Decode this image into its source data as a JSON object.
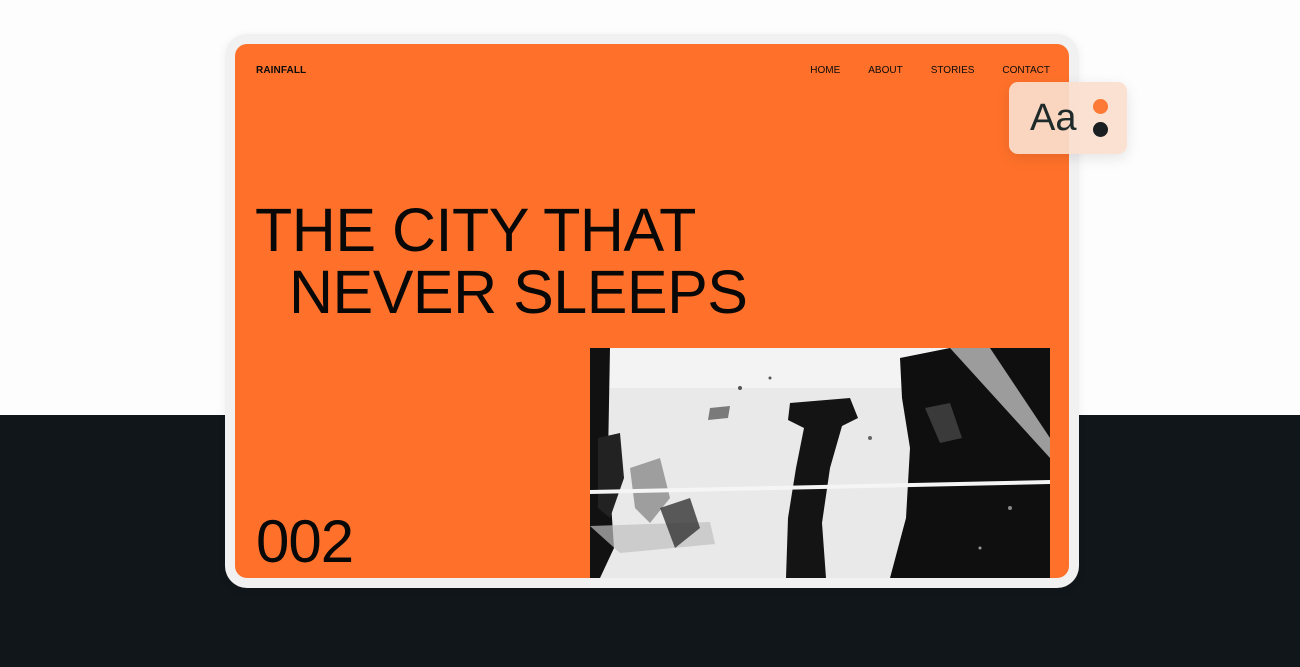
{
  "site": {
    "brand": "RAINFALL",
    "nav": [
      "HOME",
      "ABOUT",
      "STORIES",
      "CONTACT"
    ],
    "headline": {
      "line1": "THE CITY THAT",
      "line2": "NEVER SLEEPS"
    },
    "issue_number": "002",
    "accent_color": "#ff712a",
    "text_color": "#080808"
  },
  "font_card": {
    "sample": "Aa",
    "swatches": [
      {
        "name": "orange",
        "color": "#fd7a36"
      },
      {
        "name": "dark",
        "color": "#1b1f22"
      }
    ]
  },
  "background": {
    "top": "#fdfdfd",
    "bottom": "#11161a"
  }
}
